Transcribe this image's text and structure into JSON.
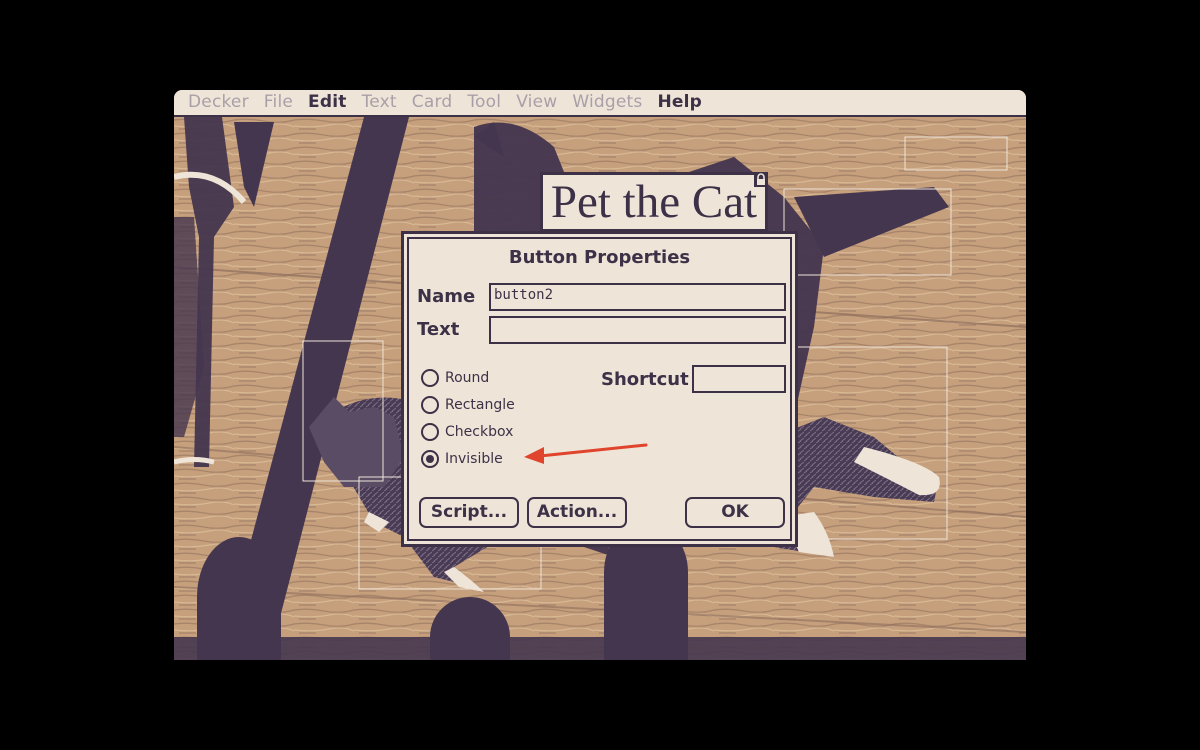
{
  "menubar": {
    "items": [
      {
        "label": "Decker",
        "enabled": false
      },
      {
        "label": "File",
        "enabled": false
      },
      {
        "label": "Edit",
        "enabled": true
      },
      {
        "label": "Text",
        "enabled": false
      },
      {
        "label": "Card",
        "enabled": false
      },
      {
        "label": "Tool",
        "enabled": false
      },
      {
        "label": "View",
        "enabled": false
      },
      {
        "label": "Widgets",
        "enabled": false
      },
      {
        "label": "Help",
        "enabled": true
      }
    ]
  },
  "card": {
    "title": "Pet the Cat",
    "title_lock_icon": "lock-icon",
    "background_image": "photo of a cat lying on a wooden floor with shadows"
  },
  "dialog": {
    "title": "Button Properties",
    "name_label": "Name",
    "name_value": "button2",
    "text_label": "Text",
    "text_value": "",
    "shortcut_label": "Shortcut",
    "shortcut_value": "",
    "styles": [
      {
        "label": "Round",
        "checked": false
      },
      {
        "label": "Rectangle",
        "checked": false
      },
      {
        "label": "Checkbox",
        "checked": false
      },
      {
        "label": "Invisible",
        "checked": true
      }
    ],
    "buttons": {
      "script": "Script...",
      "action": "Action...",
      "ok": "OK"
    }
  },
  "annotation": {
    "arrow_color": "#e0442c",
    "points_to": "Invisible"
  },
  "colors": {
    "ink": "#3d3148",
    "paper": "#eee5d8",
    "wood_light": "#c6a07c",
    "wood_dark": "#9c7a66",
    "shadow": "#45364f"
  }
}
